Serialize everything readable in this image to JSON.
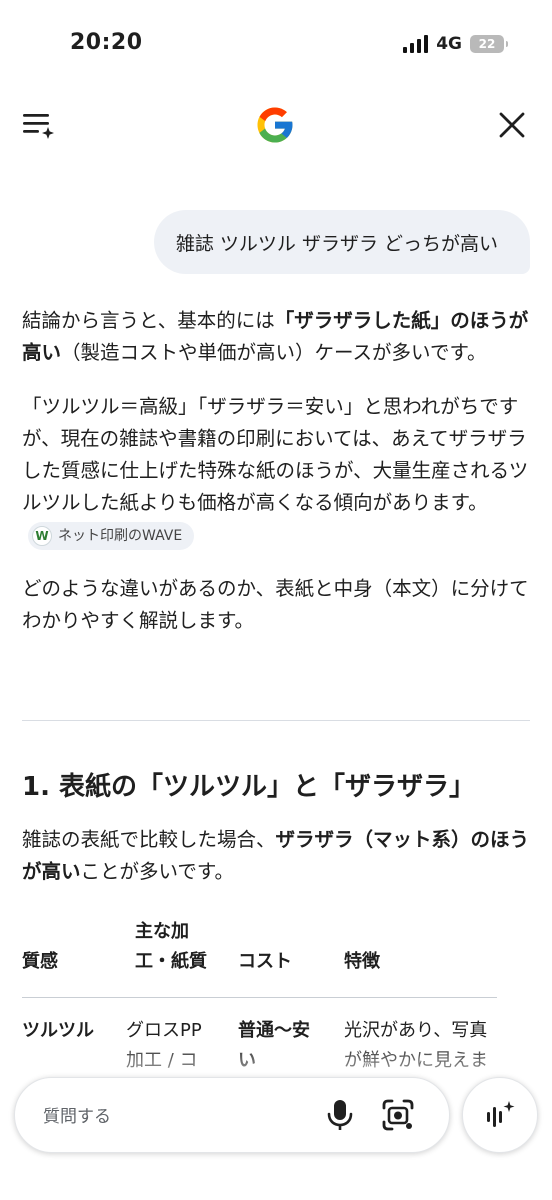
{
  "status": {
    "time": "20:20",
    "network": "4G",
    "battery": "22"
  },
  "query": "雑誌 ツルツル ザラザラ どっちが高い",
  "answer": {
    "p1": [
      "結論から言うと、基本的には",
      "「ザラザラした紙」のほうが高い",
      "（製造コストや単価が高い）ケースが多いです。"
    ],
    "p2": "「ツルツル＝高級」「ザラザラ＝安い」と思われがちですが、現在の雑誌や書籍の印刷においては、あえてザラザラした質感に仕上げた特殊な紙のほうが、大量生産されるツルツルした紙よりも価格が高くなる傾向があります。",
    "source_chip": "ネット印刷のWAVE",
    "p3": "どのような違いがあるのか、表紙と中身（本文）に分けてわかりやすく解説します。"
  },
  "section": {
    "heading": "1. 表紙の「ツルツル」と「ザラザラ」",
    "intro": [
      "雑誌の表紙で比較した場合、",
      "ザラザラ（マット系）のほうが高い",
      "ことが多いです。"
    ]
  },
  "table": {
    "headers": [
      "質感",
      "主な加工・紙質",
      "コスト",
      "特徴"
    ],
    "rows": [
      {
        "texture": "ツルツル",
        "process": "グロスPP加工 / コ",
        "cost": "普通〜安い",
        "feature": "光沢があり、写真が鮮やかに見えま"
      }
    ]
  },
  "ask_bar": {
    "placeholder": "質問する"
  },
  "colors": {
    "bubble": "#eef1f6",
    "text": "#1f1f1f",
    "google_blue": "#4285F4",
    "google_red": "#EA4335",
    "google_yellow": "#FBBC05",
    "google_green": "#34A853"
  }
}
